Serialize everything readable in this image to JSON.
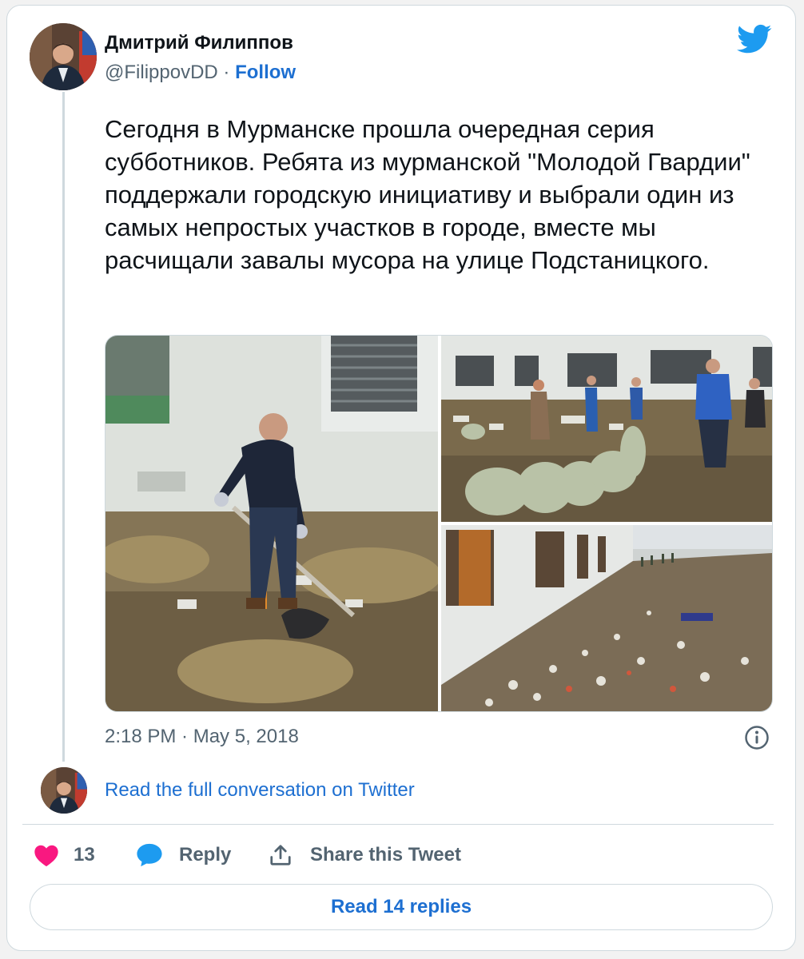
{
  "author": {
    "name": "Дмитрий Филиппов",
    "handle": "@FilippovDD",
    "separator": "·",
    "follow_label": "Follow"
  },
  "tweet": {
    "text": "Сегодня в Мурманске прошла очередная серия субботников. Ребята из мурманской \"Молодой Гвардии\" поддержали городскую инициативу и выбрали один из самых непростых участков в городе, вместе мы расчищали завалы мусора на улице Подстаницкого.",
    "timestamp": "2:18 PM · May 5, 2018"
  },
  "conversation_link": "Read the full conversation on Twitter",
  "actions": {
    "like_count": "13",
    "reply_label": "Reply",
    "share_label": "Share this Tweet"
  },
  "read_replies_label": "Read 14 replies",
  "icons": {
    "brand": "twitter-bird-icon",
    "info": "info-icon",
    "like": "heart-icon",
    "reply": "speech-bubble-icon",
    "share": "share-upload-icon"
  },
  "colors": {
    "twitter_blue": "#1d9bf0",
    "link": "#1d6fd1",
    "heart": "#f91880",
    "secondary_text": "#536471",
    "border": "#cfd9de"
  }
}
